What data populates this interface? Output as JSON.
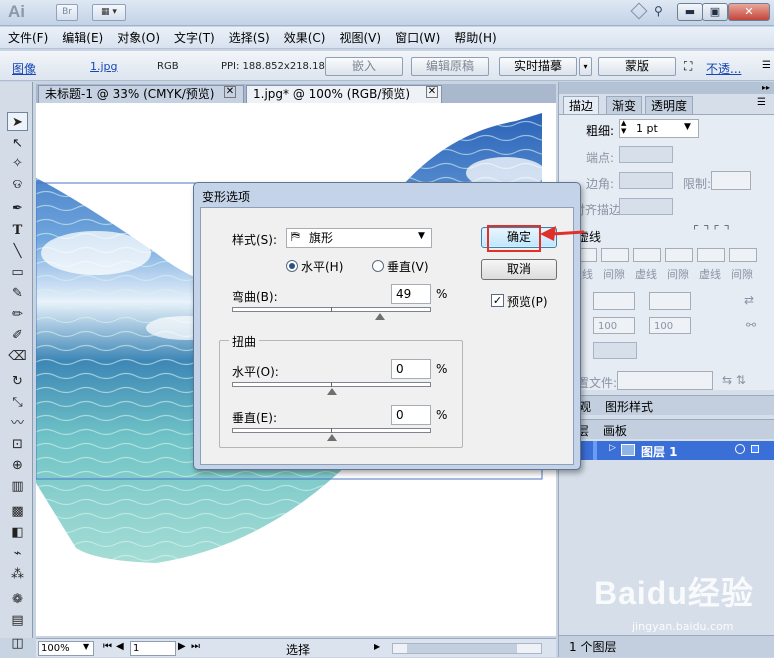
{
  "app": {
    "logo": "Ai",
    "br_badge": "Br"
  },
  "menu": [
    "文件(F)",
    "编辑(E)",
    "对象(O)",
    "文字(T)",
    "选择(S)",
    "效果(C)",
    "视图(V)",
    "窗口(W)",
    "帮助(H)"
  ],
  "control_bar": {
    "object_type": "图像",
    "file_link": "1.jpg",
    "color_mode": "RGB",
    "ppi": "PPI: 188.852x218.182",
    "embed_button": "嵌入",
    "edit_original_button": "编辑原稿",
    "live_trace_button": "实时描摹",
    "mask_button": "蒙版",
    "opacity_link": "不透..."
  },
  "tabs": [
    {
      "label": "未标题-1 @ 33% (CMYK/预览)"
    },
    {
      "label": "1.jpg* @ 100% (RGB/预览)"
    }
  ],
  "status_bar": {
    "zoom": "100%",
    "page": "1",
    "tool": "选择"
  },
  "right_panel": {
    "tabs": [
      "描边",
      "渐变",
      "透明度"
    ],
    "weight_label": "粗细:",
    "weight_value": "1 pt",
    "cap_label": "端点:",
    "corner_label": "边角:",
    "limit_label": "限制:",
    "align_label": "对齐描边:",
    "dashed_label": "虚线",
    "dash_cells": [
      "虚线",
      "间隙",
      "虚线",
      "间隙",
      "虚线",
      "间隙"
    ],
    "pct_value_1": "100",
    "pct_value_2": "100",
    "profile_label": "配置文件:",
    "lower_tabs": [
      "外观",
      "图形样式"
    ],
    "layer_tabs": [
      "图层",
      "画板"
    ],
    "layer_name": "图层 1",
    "layer_count": "1 个图层"
  },
  "dialog": {
    "title": "变形选项",
    "style_label": "样式(S):",
    "style_value": "旗形",
    "horizontal_radio": "水平(H)",
    "vertical_radio": "垂直(V)",
    "orientation_selected": "horizontal",
    "bend_label": "弯曲(B):",
    "bend_value": "49",
    "bend_percent": 49,
    "pct": "%",
    "distortion_group": "扭曲",
    "dist_h_label": "水平(O):",
    "dist_h_value": "0",
    "dist_h_percent": 0,
    "dist_v_label": "垂直(E):",
    "dist_v_value": "0",
    "dist_v_percent": 0,
    "ok_button": "确定",
    "cancel_button": "取消",
    "preview_label": "预览(P)",
    "preview_checked": true
  },
  "watermark": {
    "brand": "Baidu经验",
    "url": "jingyan.baidu.com"
  },
  "colors": {
    "accent": "#1f5fd6",
    "highlight": "#e0302a",
    "selection": "#3a6fd8"
  }
}
